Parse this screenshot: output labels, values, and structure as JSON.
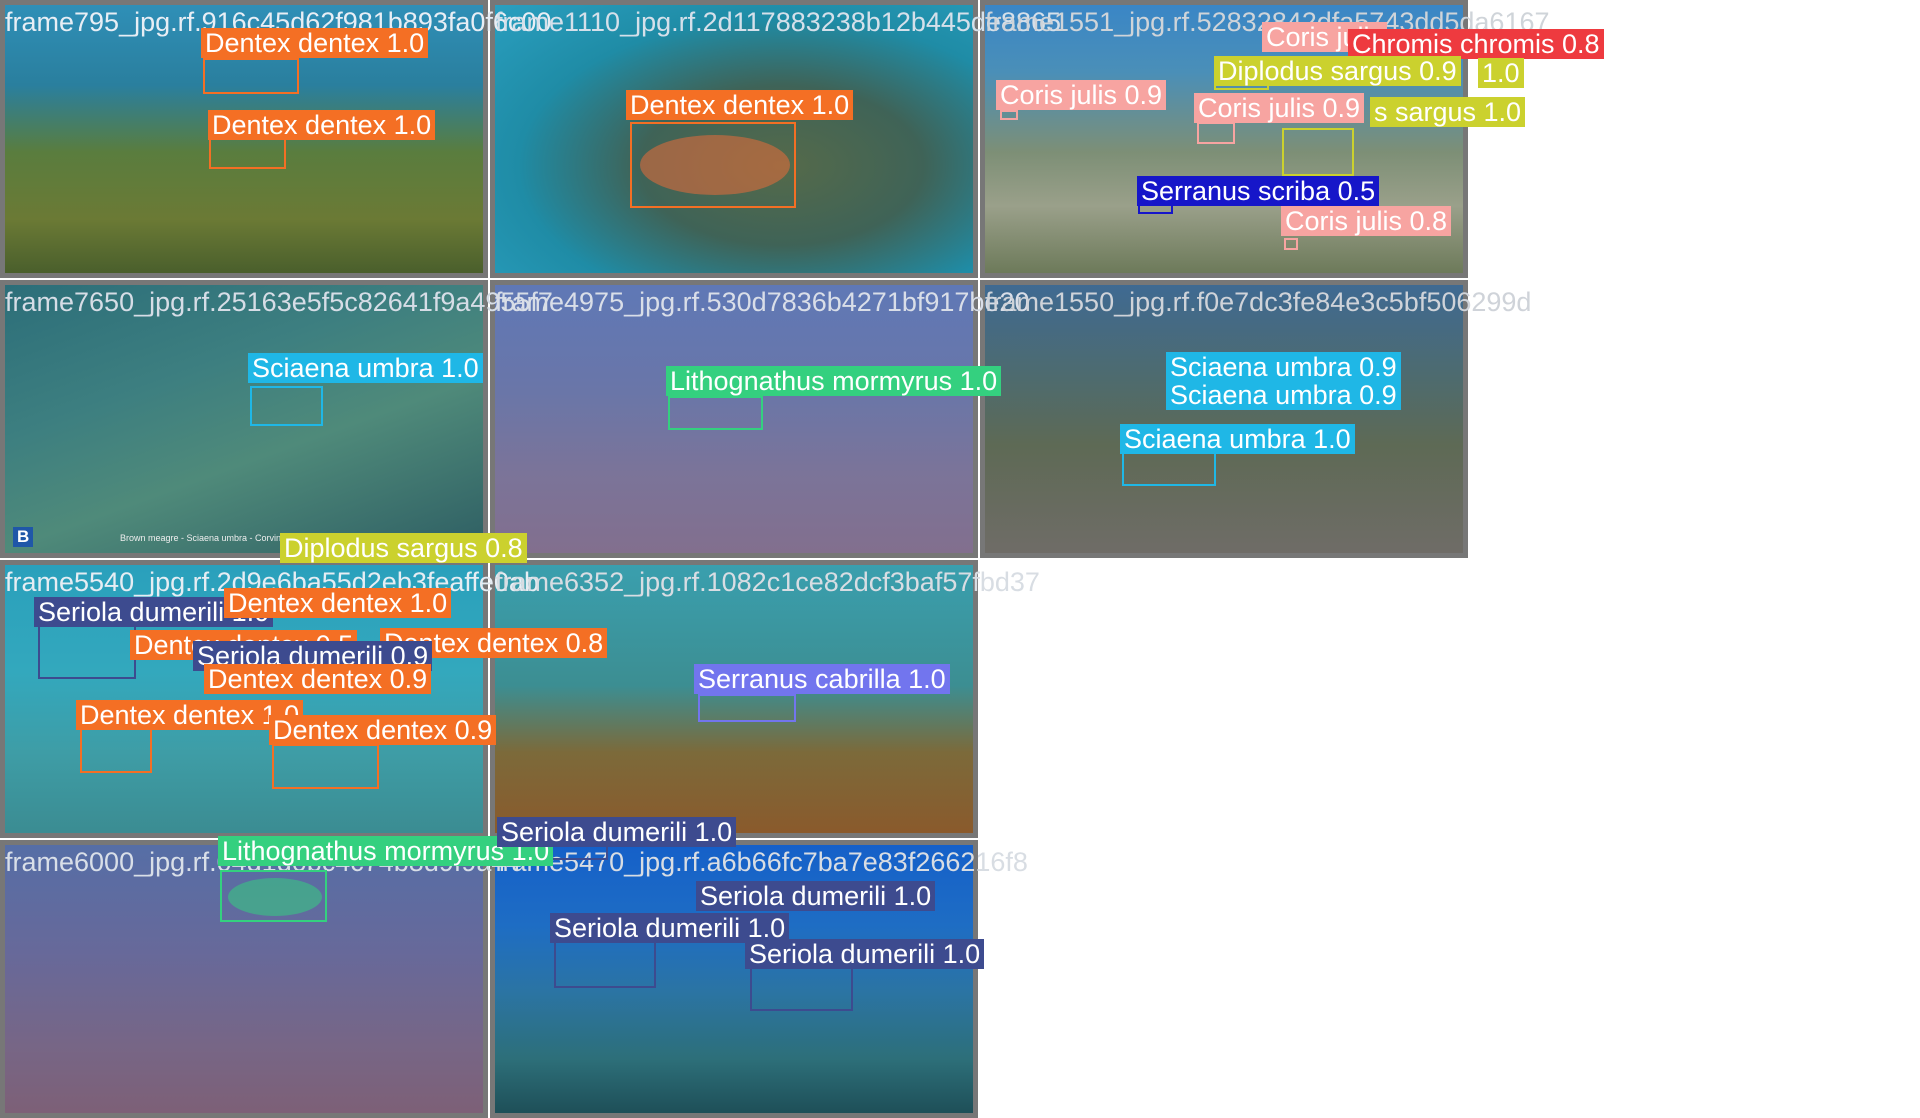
{
  "tiles": [
    {
      "name": "frame795_jpg.rf.916c45d62f981b893fa0f6c00"
    },
    {
      "name": "frame1110_jpg.rf.2d117883238b12b445de8865"
    },
    {
      "name": "frame1551_jpg.rf.52832842dfa5743dd5da6167"
    },
    {
      "name": "frame7650_jpg.rf.25163e5f5c82641f9a4955f7"
    },
    {
      "name": "frame4975_jpg.rf.530d7836b4271bf917be20"
    },
    {
      "name": "frame1550_jpg.rf.f0e7dc3fe84e3c5bf506299d"
    },
    {
      "name": "frame5540_jpg.rf.2d9e6ba55d2eb3feaffe0ab"
    },
    {
      "name": "frame6352_jpg.rf.1082c1ce82dcf3baf57fbd37"
    },
    {
      "name": "frame6000_jpg.rf.04d1d0bc4c74b8d9f9a44"
    },
    {
      "name": "frame5470_jpg.rf.a6b66fc7ba7e83f266216f8"
    }
  ],
  "tile7_caption": "Brown meagre - Sciaena umbra - Corvina",
  "tile7_corner_badge": "B",
  "detections": [
    "Dentex dentex 1.0",
    "Dentex dentex 1.0",
    "Dentex dentex 1.0",
    "Coris julis",
    "Chromis chromis 0.8",
    "Diplodus sargus 0.9",
    "1.0",
    "Coris julis 0.9",
    "Coris julis 0.9",
    "s sargus 1.0",
    "Serranus scriba 0.5",
    "Coris julis 0.8",
    "Sciaena umbra 1.0",
    "Lithognathus mormyrus 1.0",
    "Sciaena umbra 0.9",
    "Sciaena umbra 0.9",
    "Sciaena umbra 1.0",
    "Diplodus sargus 0.8",
    "Seriola dumerili 1.0",
    "Dentex dentex 1.0",
    "Dentex dentex 0.5",
    "Dentex dentex 0.8",
    "Seriola dumerili 0.9",
    "Dentex dentex 0.9",
    "Dentex dentex 1.0",
    "Dentex dentex 0.9",
    "Serranus cabrilla 1.0",
    "Lithognathus mormyrus 1.0",
    "Seriola dumerili 1.0",
    "Seriola dumerili 1.0",
    "Seriola dumerili 1.0",
    "Seriola dumerili 1.0"
  ],
  "class_colors": {
    "Dentex dentex": "#f46f24",
    "Coris julis": "#f7a4a1",
    "Chromis chromis": "#ee3a3f",
    "Diplodus sargus": "#cbd12e",
    "Serranus scriba": "#1616c9",
    "Sciaena umbra": "#1fb7e6",
    "Lithognathus mormyrus": "#34d07f",
    "Seriola dumerili": "#3d4b8f",
    "Serranus cabrilla": "#7275ee"
  }
}
